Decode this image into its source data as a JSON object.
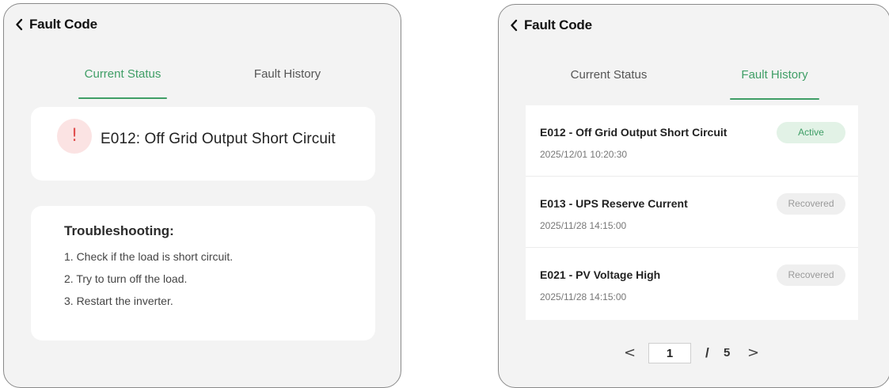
{
  "left": {
    "header": {
      "title": "Fault Code",
      "back_icon": "chevron-left-icon"
    },
    "tabs": [
      {
        "label": "Current Status",
        "active": true
      },
      {
        "label": "Fault History",
        "active": false
      }
    ],
    "fault": {
      "icon": "alert-icon",
      "icon_glyph": "!",
      "title": "E012: Off Grid Output Short Circuit"
    },
    "troubleshooting": {
      "heading": "Troubleshooting:",
      "steps": [
        "1. Check if the load is short circuit.",
        "2. Try to turn off the load.",
        "3. Restart the inverter."
      ]
    }
  },
  "right": {
    "header": {
      "title": "Fault Code",
      "back_icon": "chevron-left-icon"
    },
    "tabs": [
      {
        "label": "Current Status",
        "active": false
      },
      {
        "label": "Fault History",
        "active": true
      }
    ],
    "history": [
      {
        "title": "E012 - Off Grid Output Short Circuit",
        "time": "2025/12/01 10:20:30",
        "status": "Active"
      },
      {
        "title": "E013 - UPS Reserve Current",
        "time": "2025/11/28 14:15:00",
        "status": "Recovered"
      },
      {
        "title": "E021 - PV Voltage High",
        "time": "2025/11/28 14:15:00",
        "status": "Recovered"
      }
    ],
    "pagination": {
      "prev": "<",
      "current": "1",
      "separator": "/",
      "total": "5",
      "next": ">"
    }
  },
  "colors": {
    "accent": "#3f9e66",
    "panel_bg": "#f3f3f3",
    "alert": "#e05050",
    "alert_bg": "#fbe3e3"
  }
}
